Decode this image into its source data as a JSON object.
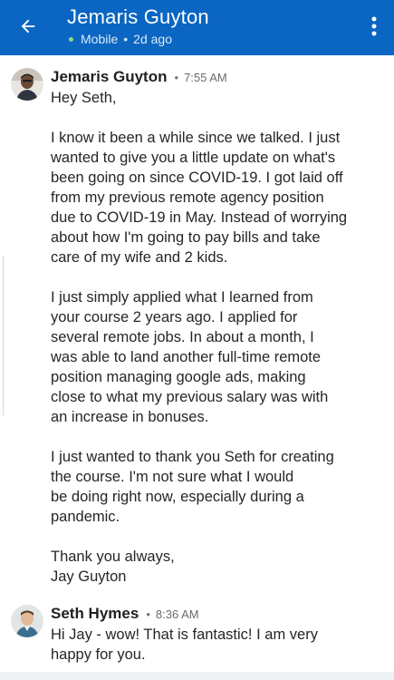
{
  "header": {
    "title": "Jemaris Guyton",
    "status": "Mobile",
    "last_seen": "2d ago",
    "colors": {
      "bar": "#0a66c2",
      "online": "#8fd98a"
    },
    "icons": {
      "back": "arrow-back-icon",
      "more": "more-vertical-icon"
    }
  },
  "messages": [
    {
      "sender": "Jemaris Guyton",
      "time": "7:55 AM",
      "lines": [
        "Hey Seth,",
        "",
        "I know it been a while since we talked. I just",
        "wanted to give you a little update on what's",
        "been going on since COVID-19. I got laid off",
        "from my previous remote agency position",
        "due to COVID-19 in May. Instead of worrying",
        "about how I'm going to pay bills and take",
        "care of my wife and 2 kids.",
        "",
        "I just simply applied what I learned from",
        "your course 2 years ago. I applied for",
        "several remote jobs. In about a month, I",
        "was able to land another full-time remote",
        "position managing google ads, making",
        "close to what my previous salary was with",
        "an increase in bonuses.",
        "",
        "I just wanted to thank you Seth for creating",
        "the course. I'm not sure what I would",
        "be doing right now, especially during a",
        "pandemic.",
        "",
        "Thank you always,",
        "Jay Guyton"
      ]
    },
    {
      "sender": "Seth Hymes",
      "time": "8:36 AM",
      "lines": [
        "Hi Jay - wow! That is fantastic! I am very",
        "happy for you."
      ]
    }
  ]
}
